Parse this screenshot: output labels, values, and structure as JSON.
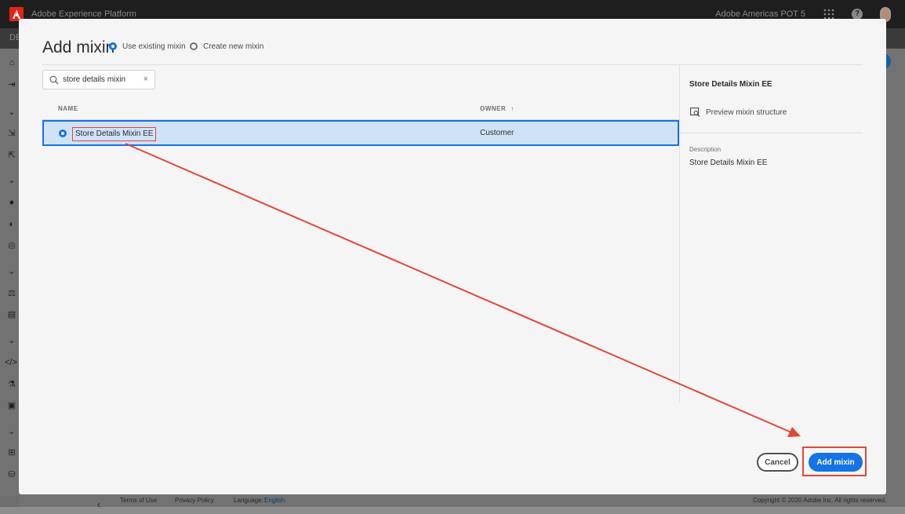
{
  "app": {
    "title": "Adobe Experience Platform",
    "org": "Adobe Americas POT 5",
    "subbar_text": "DE"
  },
  "modal": {
    "title": "Add mixin",
    "options": [
      {
        "label": "Use existing mixin",
        "selected": true
      },
      {
        "label": "Create new mixin",
        "selected": false
      }
    ],
    "search": {
      "value": "store details mixin"
    },
    "table": {
      "columns": [
        "NAME",
        "OWNER"
      ],
      "sort_indicator": "↑",
      "rows": [
        {
          "name": "Store Details Mixin EE",
          "owner": "Customer",
          "selected": true
        }
      ]
    },
    "details": {
      "title": "Store Details Mixin EE",
      "preview_label": "Preview mixin structure",
      "description_label": "Description",
      "description_value": "Store Details Mixin EE"
    },
    "buttons": {
      "cancel": "Cancel",
      "add": "Add mixin"
    }
  },
  "footer": {
    "terms": "Terms of Use",
    "privacy": "Privacy Policy",
    "language_label": "Language:",
    "language_value": "English",
    "copyright": "Copyright © 2020 Adobe Inc. All rights reserved."
  },
  "colors": {
    "accent": "#1473e6",
    "annotation": "#e2463a",
    "selected_row": "#d0e2f8"
  },
  "annotation": {
    "type": "arrow",
    "from": "selected-row-name",
    "to": "add-mixin-button"
  }
}
